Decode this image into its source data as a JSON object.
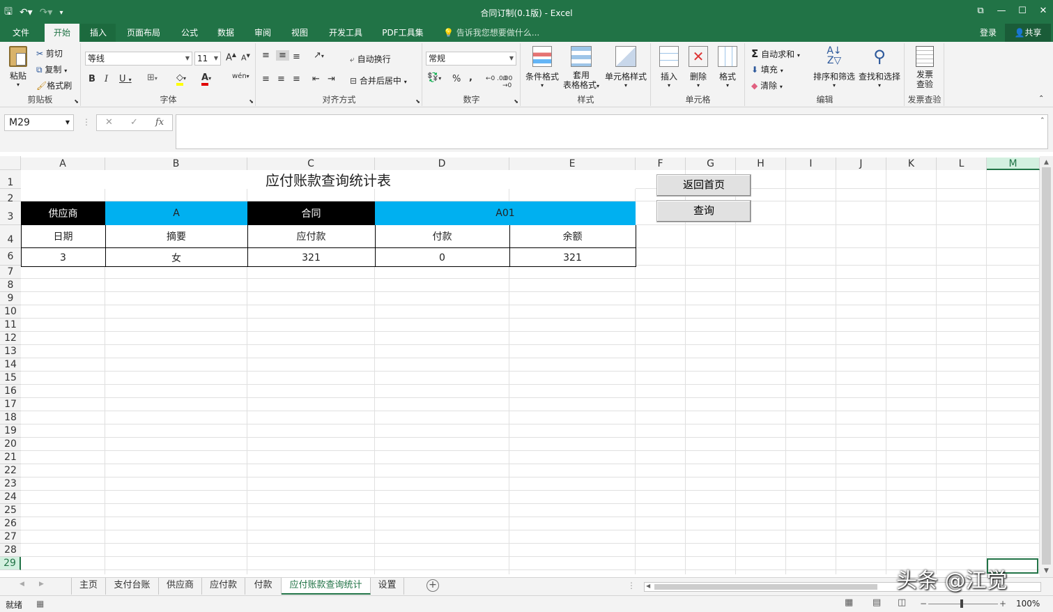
{
  "window": {
    "title": "合同订制(0.1版) - Excel",
    "qat_icons": [
      "save-icon",
      "undo-icon",
      "redo-icon",
      "customize-icon"
    ]
  },
  "menu": {
    "tabs": [
      "文件",
      "开始",
      "插入",
      "页面布局",
      "公式",
      "数据",
      "审阅",
      "视图",
      "开发工具",
      "PDF工具集"
    ],
    "active_tab": "开始",
    "tell_me": "告诉我您想要做什么...",
    "login": "登录",
    "share": "共享"
  },
  "ribbon": {
    "clipboard": {
      "label": "剪贴板",
      "paste": "粘贴",
      "cut": "剪切",
      "copy": "复制",
      "format_painter": "格式刷"
    },
    "font": {
      "label": "字体",
      "name": "等线",
      "size": "11",
      "grow": "A",
      "shrink": "A",
      "bold": "B",
      "italic": "I",
      "underline": "U",
      "phonetic": "wén",
      "font_color_glyph": "A"
    },
    "alignment": {
      "label": "对齐方式",
      "wrap": "自动换行",
      "merge": "合并后居中"
    },
    "number": {
      "label": "数字",
      "format": "常规",
      "percent": "%",
      "comma": ",",
      "inc_decimal": "←0 .00",
      "dec_decimal": ".00 →0"
    },
    "styles": {
      "label": "样式",
      "conditional": "条件格式",
      "table_line1": "套用",
      "table_line2": "表格格式",
      "cell_styles": "单元格样式"
    },
    "cells": {
      "label": "单元格",
      "insert": "插入",
      "delete": "删除",
      "format": "格式"
    },
    "editing": {
      "label": "编辑",
      "autosum": "自动求和",
      "fill": "填充",
      "clear": "清除",
      "sort": "排序和筛选",
      "find": "查找和选择"
    },
    "invoice": {
      "label": "发票查验",
      "btn_line1": "发票",
      "btn_line2": "查验"
    }
  },
  "formula_bar": {
    "name_box": "M29",
    "cancel": "✕",
    "enter": "✓",
    "fx": "fx",
    "content": ""
  },
  "grid": {
    "columns": [
      "A",
      "B",
      "C",
      "D",
      "E",
      "F",
      "G",
      "H",
      "I",
      "J",
      "K",
      "L",
      "M"
    ],
    "selected_column": "M",
    "rows": [
      "1",
      "2",
      "3",
      "4",
      "6",
      "7",
      "8",
      "9",
      "10",
      "11",
      "12",
      "13",
      "14",
      "15",
      "16",
      "17",
      "18",
      "19",
      "20",
      "21",
      "22",
      "23",
      "24",
      "25",
      "26",
      "27",
      "28",
      "29"
    ],
    "selected_row": "29"
  },
  "sheet": {
    "title": "应付账款查询统计表",
    "supplier_label": "供应商",
    "supplier_value": "A",
    "contract_label": "合同",
    "contract_value": "A01",
    "headers": [
      "日期",
      "摘要",
      "应付款",
      "付款",
      "余额"
    ],
    "row": [
      "3",
      "女",
      "321",
      "0",
      "321"
    ],
    "buttons": {
      "home": "返回首页",
      "query": "查询"
    },
    "colors": {
      "black_band": "#000000",
      "blue_band": "#00b0f0"
    }
  },
  "sheet_tabs": [
    "主页",
    "支付台账",
    "供应商",
    "应付款",
    "付款",
    "应付账款查询统计",
    "设置"
  ],
  "active_sheet": "应付账款查询统计",
  "status": {
    "ready": "就绪",
    "zoom": "100%"
  },
  "watermark": "头条 @江觉"
}
